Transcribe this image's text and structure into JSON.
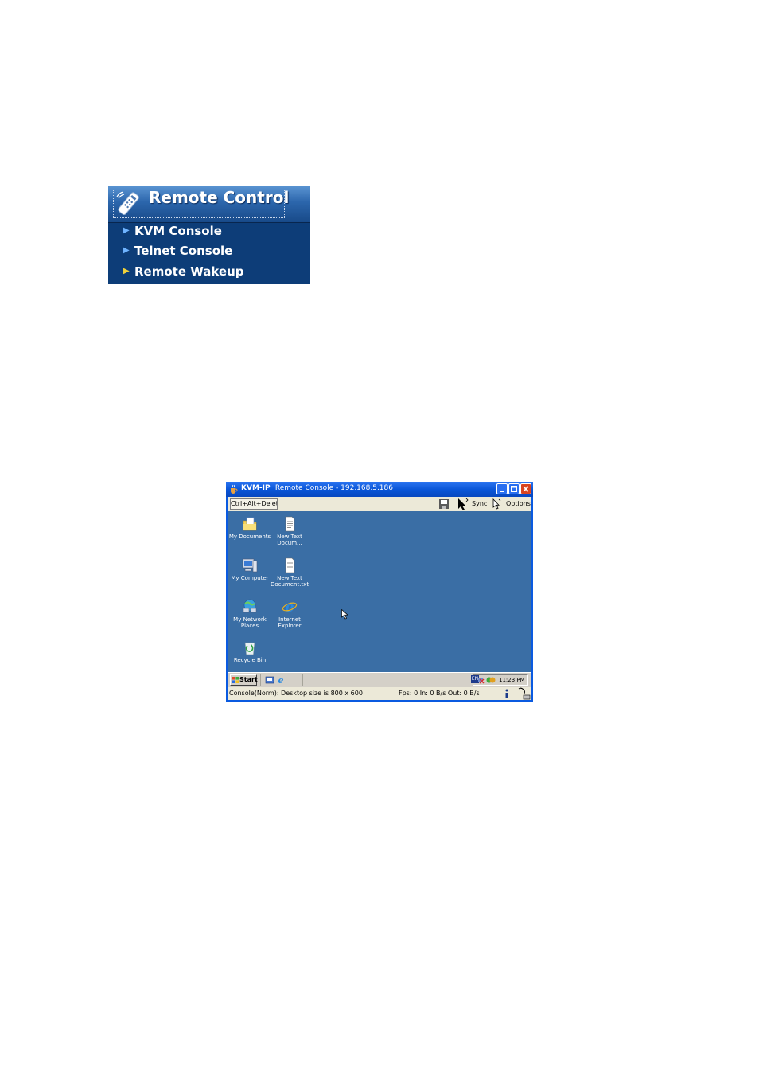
{
  "menu": {
    "title": "Remote Control",
    "items": [
      {
        "label": "KVM Console",
        "active": false
      },
      {
        "label": "Telnet Console",
        "active": false
      },
      {
        "label": "Remote Wakeup",
        "active": true
      }
    ],
    "colors": {
      "background": "#0d3d78",
      "arrow": "#6fb4ff",
      "active_arrow": "#f0d23a"
    }
  },
  "kvm_window": {
    "title_bold": "KVM-IP",
    "title_rest": "Remote Console - 192.168.5.186",
    "toolbar": {
      "cad_label": "Ctrl+Alt+Delete",
      "sync_label": "Sync",
      "options_label": "Options"
    },
    "desktop_icons": [
      {
        "label": "My Documents",
        "icon": "my-documents-icon"
      },
      {
        "label": "New Text Docum...",
        "icon": "text-document-icon"
      },
      {
        "label": "My Computer",
        "icon": "my-computer-icon"
      },
      {
        "label": "New Text Document.txt",
        "icon": "text-document-icon"
      },
      {
        "label": "My Network Places",
        "icon": "network-places-icon"
      },
      {
        "label": "Internet Explorer",
        "icon": "internet-explorer-icon"
      },
      {
        "label": "Recycle Bin",
        "icon": "recycle-bin-icon"
      }
    ],
    "taskbar": {
      "start_label": "Start",
      "tray_lang": "EN",
      "clock": "11:23 PM"
    },
    "status": {
      "left": "Console(Norm): Desktop size is 800 x 600",
      "right": "Fps: 0 In: 0 B/s Out: 0 B/s"
    },
    "colors": {
      "titlebar": "#0a56d8",
      "desktop": "#3a6ea5",
      "chrome": "#ece9d8"
    }
  }
}
